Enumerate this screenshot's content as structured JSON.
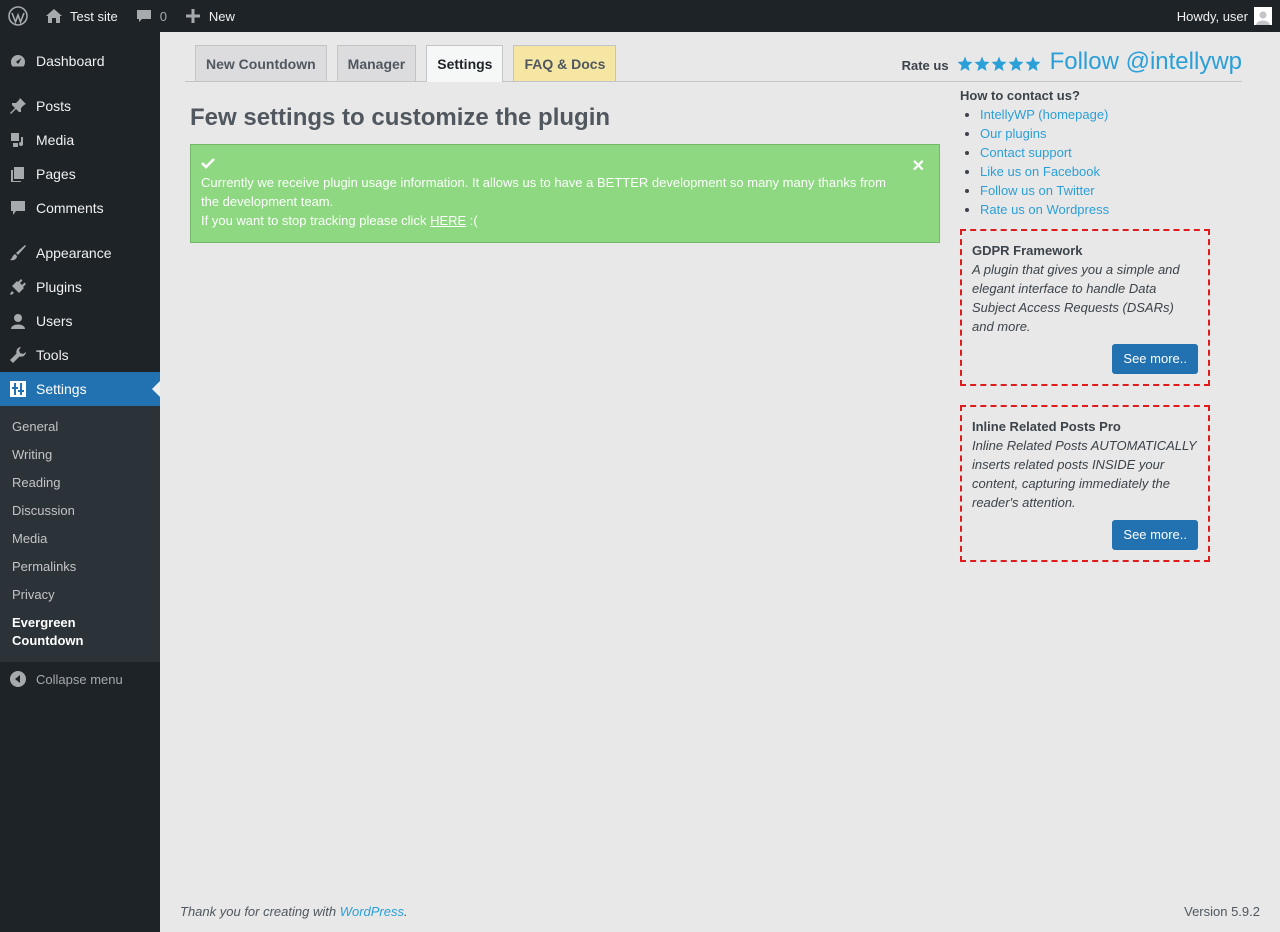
{
  "adminbar": {
    "site_name": "Test site",
    "comments_count": "0",
    "new_label": "New",
    "howdy": "Howdy, user"
  },
  "sidebar": {
    "items": [
      {
        "label": "Dashboard",
        "icon": "dashboard-icon"
      },
      {
        "label": "Posts",
        "icon": "pin-icon"
      },
      {
        "label": "Media",
        "icon": "media-icon"
      },
      {
        "label": "Pages",
        "icon": "pages-icon"
      },
      {
        "label": "Comments",
        "icon": "comment-icon"
      },
      {
        "label": "Appearance",
        "icon": "brush-icon"
      },
      {
        "label": "Plugins",
        "icon": "plug-icon"
      },
      {
        "label": "Users",
        "icon": "user-icon"
      },
      {
        "label": "Tools",
        "icon": "wrench-icon"
      },
      {
        "label": "Settings",
        "icon": "settings-icon"
      }
    ],
    "submenu": [
      "General",
      "Writing",
      "Reading",
      "Discussion",
      "Media",
      "Permalinks",
      "Privacy"
    ],
    "submenu_current_line1": "Evergreen",
    "submenu_current_line2": "Countdown",
    "collapse": "Collapse menu"
  },
  "tabs": [
    "New Countdown",
    "Manager",
    "Settings",
    "FAQ & Docs"
  ],
  "rate_label": "Rate us",
  "follow": "Follow @intellywp",
  "main": {
    "heading": "Few settings to customize the plugin",
    "notice_line1": "Currently we receive plugin usage information. It allows us to have a BETTER development so many many thanks from the development team.",
    "notice_line2_prefix": "If you want to stop tracking please click ",
    "notice_link": "HERE",
    "notice_line2_suffix": " :("
  },
  "aside": {
    "contact_title": "How to contact us?",
    "links": [
      "IntellyWP (homepage)",
      "Our plugins",
      "Contact support",
      "Like us on Facebook",
      "Follow us on Twitter",
      "Rate us on Wordpress"
    ],
    "promos": [
      {
        "title": "GDPR Framework",
        "desc": "A plugin that gives you a simple and elegant interface to handle Data Subject Access Requests (DSARs) and more.",
        "button": "See more.."
      },
      {
        "title": "Inline Related Posts Pro",
        "desc": "Inline Related Posts AUTOMATICALLY inserts related posts INSIDE your content, capturing immediately the reader's attention.",
        "button": "See more.."
      }
    ]
  },
  "footer": {
    "thanks_prefix": "Thank you for creating with ",
    "thanks_link": "WordPress",
    "thanks_suffix": ".",
    "version": "Version 5.9.2"
  }
}
